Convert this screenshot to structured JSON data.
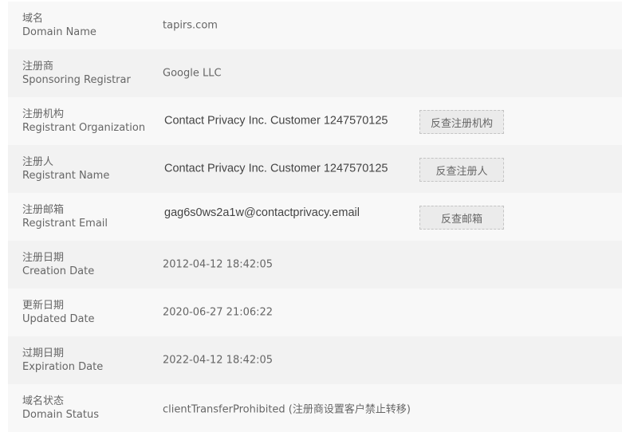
{
  "rows": [
    {
      "cn": "域名",
      "en": "Domain Name",
      "value": "tapirs.com"
    },
    {
      "cn": "注册商",
      "en": "Sponsoring Registrar",
      "value": "Google LLC"
    },
    {
      "cn": "注册机构",
      "en": "Registrant Organization",
      "value": "Contact Privacy Inc. Customer 1247570125",
      "button": "反查注册机构"
    },
    {
      "cn": "注册人",
      "en": "Registrant Name",
      "value": "Contact Privacy Inc. Customer 1247570125",
      "button": "反查注册人"
    },
    {
      "cn": "注册邮箱",
      "en": "Registrant Email",
      "value": "gag6s0ws2a1w@contactprivacy.email",
      "button": "反查邮箱"
    },
    {
      "cn": "注册日期",
      "en": "Creation Date",
      "value": "2012-04-12 18:42:05"
    },
    {
      "cn": "更新日期",
      "en": "Updated Date",
      "value": "2020-06-27 21:06:22"
    },
    {
      "cn": "过期日期",
      "en": "Expiration Date",
      "value": "2022-04-12 18:42:05"
    },
    {
      "cn": "域名状态",
      "en": "Domain Status",
      "value": "clientTransferProhibited (注册商设置客户禁止转移)"
    }
  ]
}
